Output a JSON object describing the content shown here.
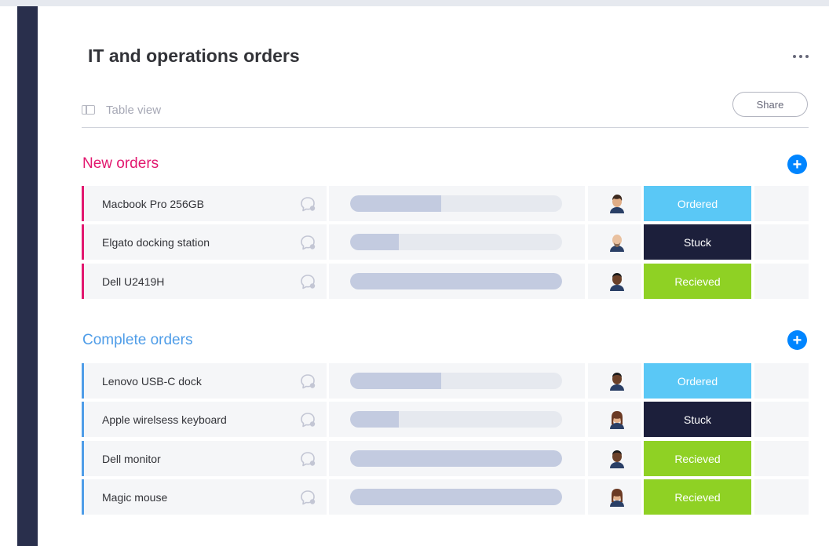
{
  "page": {
    "title": "IT and operations orders",
    "view_label": "Table view",
    "share_label": "Share",
    "more_icon": "more-horizontal-icon"
  },
  "colors": {
    "new_group": "#e2186f",
    "complete_group": "#4f9de8",
    "ordered": "#5ac8f6",
    "stuck": "#1c1f3b",
    "received": "#8fd124",
    "add_button": "#0085ff"
  },
  "groups": [
    {
      "title": "New orders",
      "add_label": "+",
      "rows": [
        {
          "name": "Macbook Pro 256GB",
          "progress": 0.43,
          "avatar": "person-avatar-curly-hair",
          "status": "Ordered"
        },
        {
          "name": "Elgato docking station",
          "progress": 0.23,
          "avatar": "person-avatar-bald-beard",
          "status": "Stuck"
        },
        {
          "name": "Dell U2419H",
          "progress": 1.0,
          "avatar": "person-avatar-dark-skin",
          "status": "Recieved"
        }
      ]
    },
    {
      "title": "Complete orders",
      "add_label": "+",
      "rows": [
        {
          "name": "Lenovo USB-C dock",
          "progress": 0.43,
          "avatar": "person-avatar-dark-skin",
          "status": "Ordered"
        },
        {
          "name": "Apple wirelsess keyboard",
          "progress": 0.23,
          "avatar": "person-avatar-long-hair",
          "status": "Stuck"
        },
        {
          "name": "Dell monitor",
          "progress": 1.0,
          "avatar": "person-avatar-dark-skin",
          "status": "Recieved"
        },
        {
          "name": "Magic mouse",
          "progress": 1.0,
          "avatar": "person-avatar-long-hair",
          "status": "Recieved"
        }
      ]
    }
  ]
}
